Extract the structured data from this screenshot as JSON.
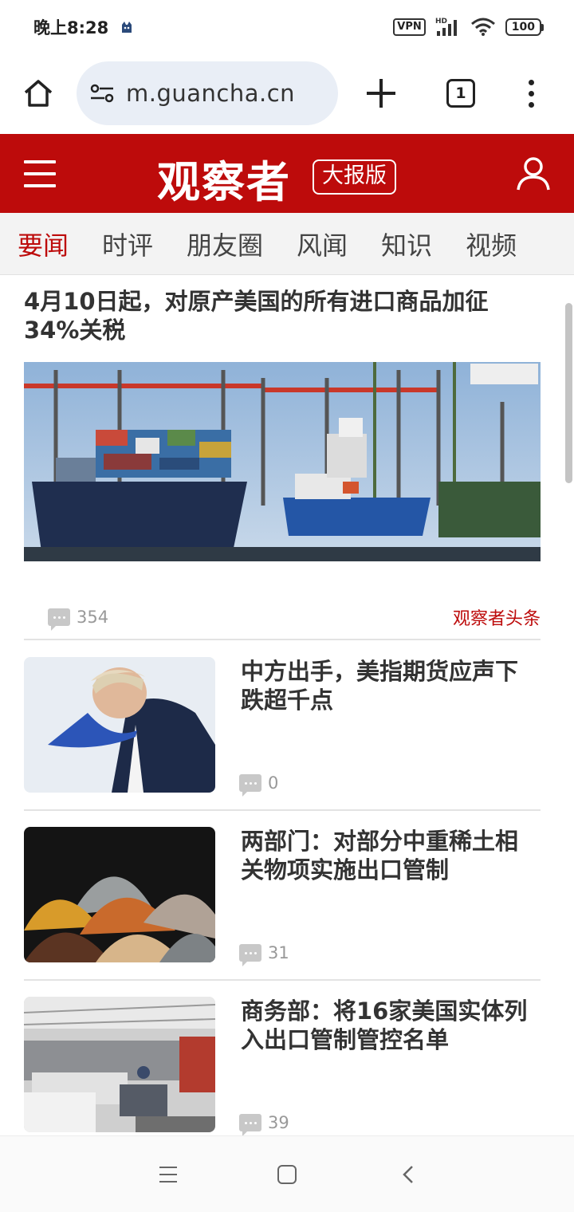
{
  "status_bar": {
    "time": "晚上8:28",
    "vpn": "VPN",
    "network": "HD",
    "battery": "100"
  },
  "browser": {
    "url": "m.guancha.cn",
    "tab_count": "1"
  },
  "site": {
    "logo": "观察者",
    "edition": "大报版",
    "accent_color": "#bd0b0b"
  },
  "categories": [
    "要闻",
    "时评",
    "朋友圈",
    "风闻",
    "知识",
    "视频"
  ],
  "headline": {
    "title": "4月10日起，对原产美国的所有进口商品加征34%关税",
    "comments": "354",
    "source": "观察者头条"
  },
  "news": [
    {
      "title": "中方出手，美指期货应声下跌超千点",
      "comments": "0"
    },
    {
      "title": "两部门：对部分中重稀土相关物项实施出口管制",
      "comments": "31"
    },
    {
      "title": "商务部：将16家美国实体列入出口管制管控名单",
      "comments": "39"
    }
  ]
}
